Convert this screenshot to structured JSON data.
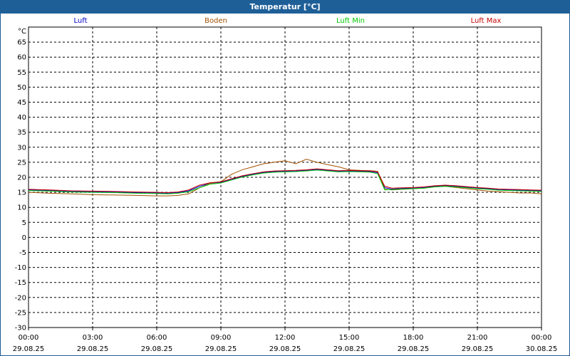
{
  "window": {
    "title": "Temperatur [°C]"
  },
  "chart_data": {
    "type": "line",
    "title": "Temperatur [°C]",
    "ylabel": "°C",
    "xlabel": "",
    "ylim": [
      -30,
      70
    ],
    "yticks": [
      -30,
      -25,
      -20,
      -15,
      -10,
      -5,
      0,
      5,
      10,
      15,
      20,
      25,
      30,
      35,
      40,
      45,
      50,
      55,
      60,
      65
    ],
    "xlim": [
      "2025-08-29T00:00",
      "2025-08-30T00:00"
    ],
    "x_tick_labels": [
      {
        "time": "00:00",
        "date": "29.08.25"
      },
      {
        "time": "03:00",
        "date": "29.08.25"
      },
      {
        "time": "06:00",
        "date": "29.08.25"
      },
      {
        "time": "09:00",
        "date": "29.08.25"
      },
      {
        "time": "12:00",
        "date": "29.08.25"
      },
      {
        "time": "15:00",
        "date": "29.08.25"
      },
      {
        "time": "18:00",
        "date": "29.08.25"
      },
      {
        "time": "21:00",
        "date": "29.08.25"
      },
      {
        "time": "00:00",
        "date": "30.08.25"
      }
    ],
    "grid": true,
    "legend_position": "top",
    "x": [
      "00:00",
      "01:00",
      "02:00",
      "03:00",
      "04:00",
      "05:00",
      "06:00",
      "06:30",
      "07:00",
      "07:30",
      "08:00",
      "08:30",
      "09:00",
      "09:30",
      "10:00",
      "10:30",
      "11:00",
      "11:30",
      "12:00",
      "12:30",
      "13:00",
      "13:30",
      "14:00",
      "14:30",
      "15:00",
      "15:30",
      "16:00",
      "16:20",
      "16:40",
      "17:00",
      "17:30",
      "18:00",
      "18:30",
      "19:00",
      "19:30",
      "20:00",
      "21:00",
      "21:30",
      "22:00",
      "22:30",
      "23:00",
      "23:30",
      "24:00"
    ],
    "series": [
      {
        "name": "Luft",
        "color": "#0000c8",
        "values": [
          15.8,
          15.6,
          15.3,
          15.2,
          15.1,
          14.9,
          14.8,
          14.7,
          14.9,
          15.5,
          17.0,
          18.0,
          18.3,
          19.3,
          20.3,
          21.0,
          21.6,
          21.9,
          22.0,
          22.1,
          22.3,
          22.6,
          22.3,
          22.0,
          22.1,
          22.0,
          21.9,
          21.5,
          16.5,
          16.1,
          16.3,
          16.4,
          16.6,
          17.0,
          17.2,
          17.0,
          16.4,
          16.2,
          15.9,
          15.8,
          15.7,
          15.6,
          15.5
        ]
      },
      {
        "name": "Boden",
        "color": "#a05000",
        "values": [
          15.0,
          14.7,
          14.5,
          14.2,
          14.1,
          14.0,
          13.8,
          13.8,
          14.0,
          14.5,
          16.5,
          18.0,
          18.5,
          21.0,
          22.5,
          23.5,
          24.5,
          25.0,
          25.5,
          24.5,
          26.0,
          25.0,
          24.2,
          23.5,
          22.5,
          22.3,
          22.2,
          22.0,
          16.0,
          15.8,
          16.0,
          16.2,
          16.4,
          16.8,
          17.0,
          16.6,
          15.8,
          15.4,
          15.2,
          15.0,
          14.8,
          14.8,
          14.5
        ]
      },
      {
        "name": "Luft Min",
        "color": "#00c800",
        "values": [
          15.6,
          15.4,
          15.1,
          15.0,
          14.9,
          14.7,
          14.6,
          14.5,
          14.7,
          15.2,
          16.5,
          17.7,
          18.1,
          19.1,
          20.1,
          20.8,
          21.4,
          21.7,
          21.8,
          21.9,
          22.1,
          22.4,
          22.1,
          21.8,
          21.9,
          21.8,
          21.7,
          21.2,
          15.8,
          15.9,
          16.1,
          16.2,
          16.4,
          16.8,
          17.0,
          16.8,
          16.2,
          16.0,
          15.7,
          15.6,
          15.5,
          15.4,
          15.3
        ]
      },
      {
        "name": "Luft Max",
        "color": "#c80000",
        "values": [
          16.0,
          15.8,
          15.5,
          15.4,
          15.3,
          15.1,
          15.0,
          14.9,
          15.1,
          15.8,
          17.4,
          18.2,
          18.5,
          19.5,
          20.5,
          21.2,
          21.8,
          22.1,
          22.2,
          22.3,
          22.5,
          22.8,
          22.5,
          22.2,
          22.3,
          22.2,
          22.1,
          21.8,
          17.0,
          16.4,
          16.5,
          16.6,
          16.8,
          17.2,
          17.4,
          17.2,
          16.6,
          16.4,
          16.1,
          16.0,
          15.9,
          15.8,
          15.7
        ]
      }
    ]
  }
}
